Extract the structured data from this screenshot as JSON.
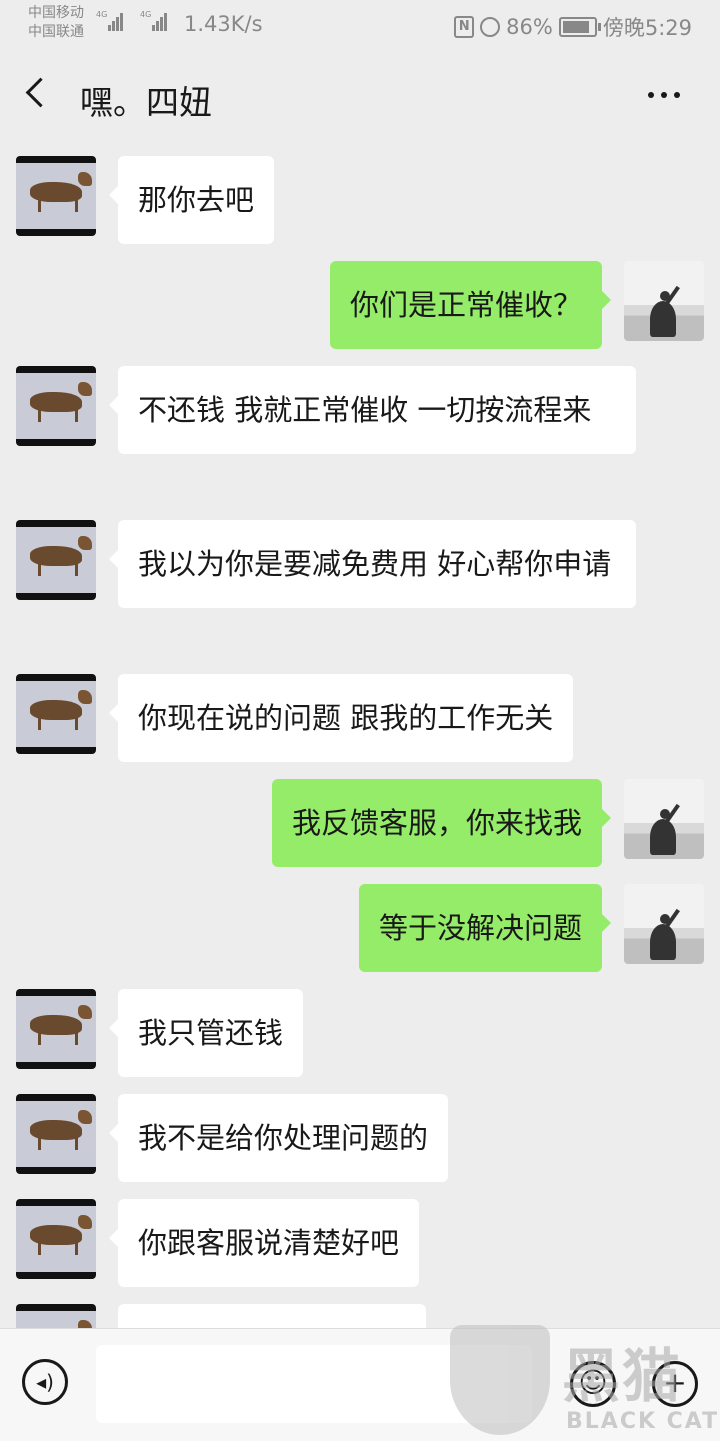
{
  "status_bar": {
    "carrier1": "中国移动",
    "carrier2": "中国联通",
    "net1": "4G",
    "net2": "4G",
    "speed": "1.43K/s",
    "nfc": "N",
    "battery": "86%",
    "battery_level": 0.86,
    "time": "傍晚5:29"
  },
  "header": {
    "title": "嘿。四妞"
  },
  "messages": [
    {
      "side": "left",
      "text": "那你去吧"
    },
    {
      "side": "right",
      "text": "你们是正常催收？"
    },
    {
      "side": "left",
      "text": "不还钱 我就正常催收 一切按流程来"
    },
    {
      "side": "left",
      "text": "我以为你是要减免费用 好心帮你申请"
    },
    {
      "side": "left",
      "text": "你现在说的问题 跟我的工作无关"
    },
    {
      "side": "right",
      "text": "我反馈客服，你来找我"
    },
    {
      "side": "right",
      "text": "等于没解决问题"
    },
    {
      "side": "left",
      "text": "我只管还钱"
    },
    {
      "side": "left",
      "text": "我不是给你处理问题的"
    },
    {
      "side": "left",
      "text": "你跟客服说清楚好吧"
    },
    {
      "side": "left",
      "text": ""
    }
  ],
  "input_bar": {
    "voice_icon": "voice-icon",
    "emoji_icon": "emoji-icon",
    "plus_icon": "plus-icon"
  },
  "watermark": {
    "cn": "黑猫",
    "en": "BLACK CAT"
  }
}
